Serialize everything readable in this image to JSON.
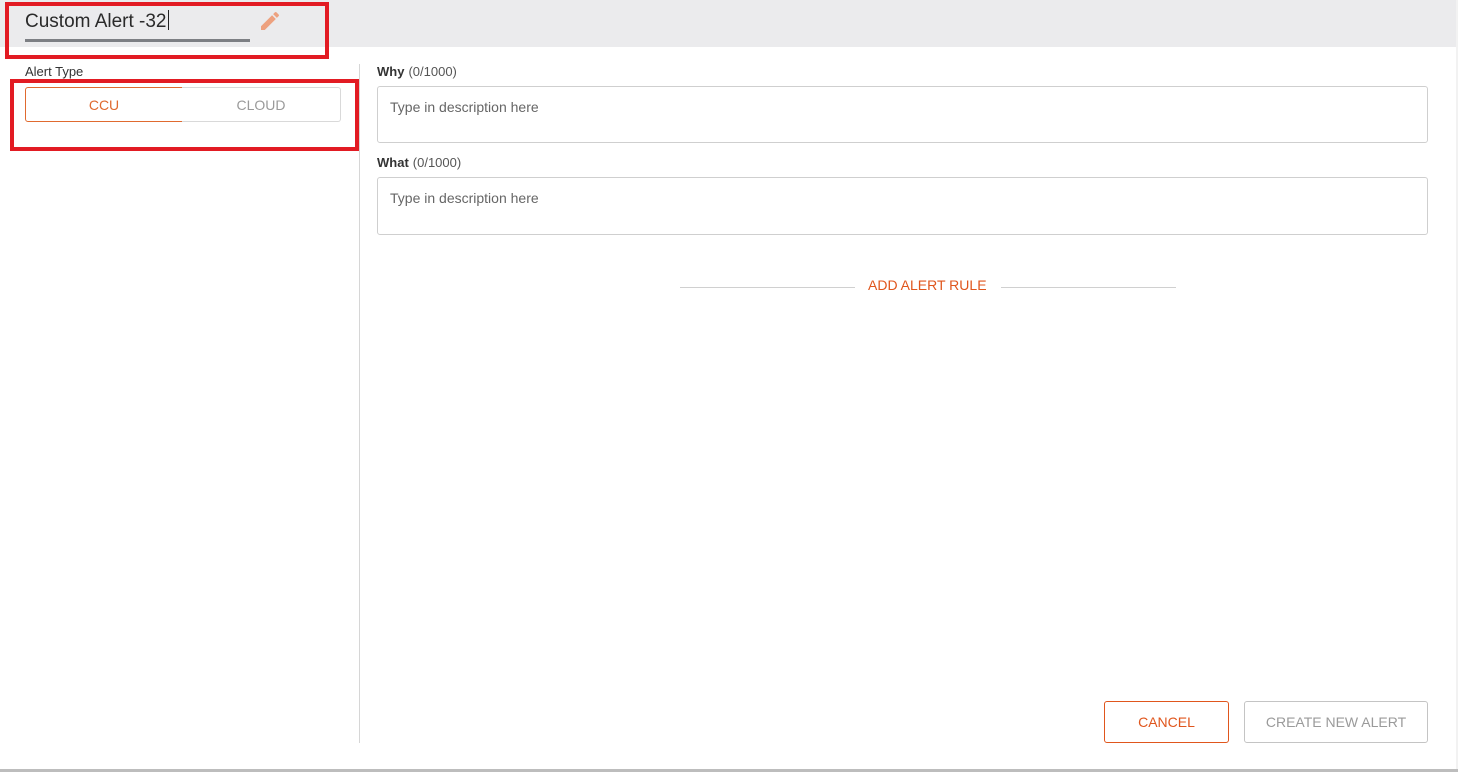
{
  "header": {
    "alert_name": "Custom Alert -32",
    "edit_icon": "pencil-icon",
    "accent_color": "#e06a2f"
  },
  "alert_type": {
    "label": "Alert Type",
    "options": [
      "CCU",
      "CLOUD"
    ],
    "selected": "CCU"
  },
  "why": {
    "label": "Why",
    "count": "(0/1000)",
    "placeholder": "Type in description here",
    "value": ""
  },
  "what": {
    "label": "What",
    "count": "(0/1000)",
    "placeholder": "Type in description here",
    "value": ""
  },
  "rules": {
    "add_label": "ADD ALERT RULE"
  },
  "footer": {
    "cancel_label": "CANCEL",
    "create_label": "CREATE NEW ALERT"
  }
}
